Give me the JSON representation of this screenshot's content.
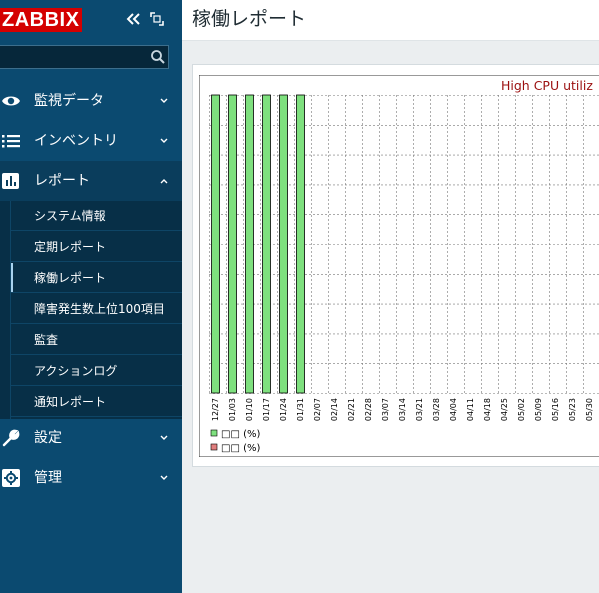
{
  "brand": {
    "logo_text": "ZABBIX",
    "color": "#d40000"
  },
  "sidebar": {
    "collapse_icon": "double-chevron-left-icon",
    "kiosk_icon": "expand-icon",
    "search": {
      "value": "",
      "icon": "search-icon"
    },
    "menu": [
      {
        "label": "監視データ",
        "icon": "eye-icon",
        "expanded": false
      },
      {
        "label": "インベントリ",
        "icon": "list-icon",
        "expanded": false
      },
      {
        "label": "レポート",
        "icon": "bar-chart-icon",
        "expanded": true
      },
      {
        "label": "設定",
        "icon": "wrench-icon",
        "expanded": false
      },
      {
        "label": "管理",
        "icon": "gear-icon",
        "expanded": false
      }
    ],
    "reports_submenu": [
      {
        "label": "システム情報"
      },
      {
        "label": "定期レポート"
      },
      {
        "label": "稼働レポート",
        "active": true
      },
      {
        "label": "障害発生数上位100項目"
      },
      {
        "label": "監査"
      },
      {
        "label": "アクションログ"
      },
      {
        "label": "通知レポート"
      }
    ]
  },
  "header": {
    "title": "稼働レポート"
  },
  "chart_data": {
    "type": "bar",
    "title": "High CPU utiliz",
    "categories": [
      "12/27",
      "01/03",
      "01/10",
      "01/17",
      "01/24",
      "01/31",
      "02/07",
      "02/14",
      "02/21",
      "02/28",
      "03/07",
      "03/14",
      "03/21",
      "03/28",
      "04/04",
      "04/11",
      "04/18",
      "04/25",
      "05/02",
      "05/09",
      "05/16",
      "05/23",
      "05/30"
    ],
    "series": [
      {
        "name": "□□ (%)",
        "color": "#7ee07e",
        "values": [
          100,
          100,
          100,
          100,
          100,
          100,
          0,
          0,
          0,
          0,
          0,
          0,
          0,
          0,
          0,
          0,
          0,
          0,
          0,
          0,
          0,
          0,
          0
        ]
      },
      {
        "name": "□□ (%)",
        "color": "#e07e7e",
        "values": [
          0,
          0,
          0,
          0,
          0,
          0,
          0,
          0,
          0,
          0,
          0,
          0,
          0,
          0,
          0,
          0,
          0,
          0,
          0,
          0,
          0,
          0,
          0
        ]
      }
    ],
    "ylim": [
      0,
      100
    ],
    "grid": true,
    "legend": "bottom-left"
  }
}
